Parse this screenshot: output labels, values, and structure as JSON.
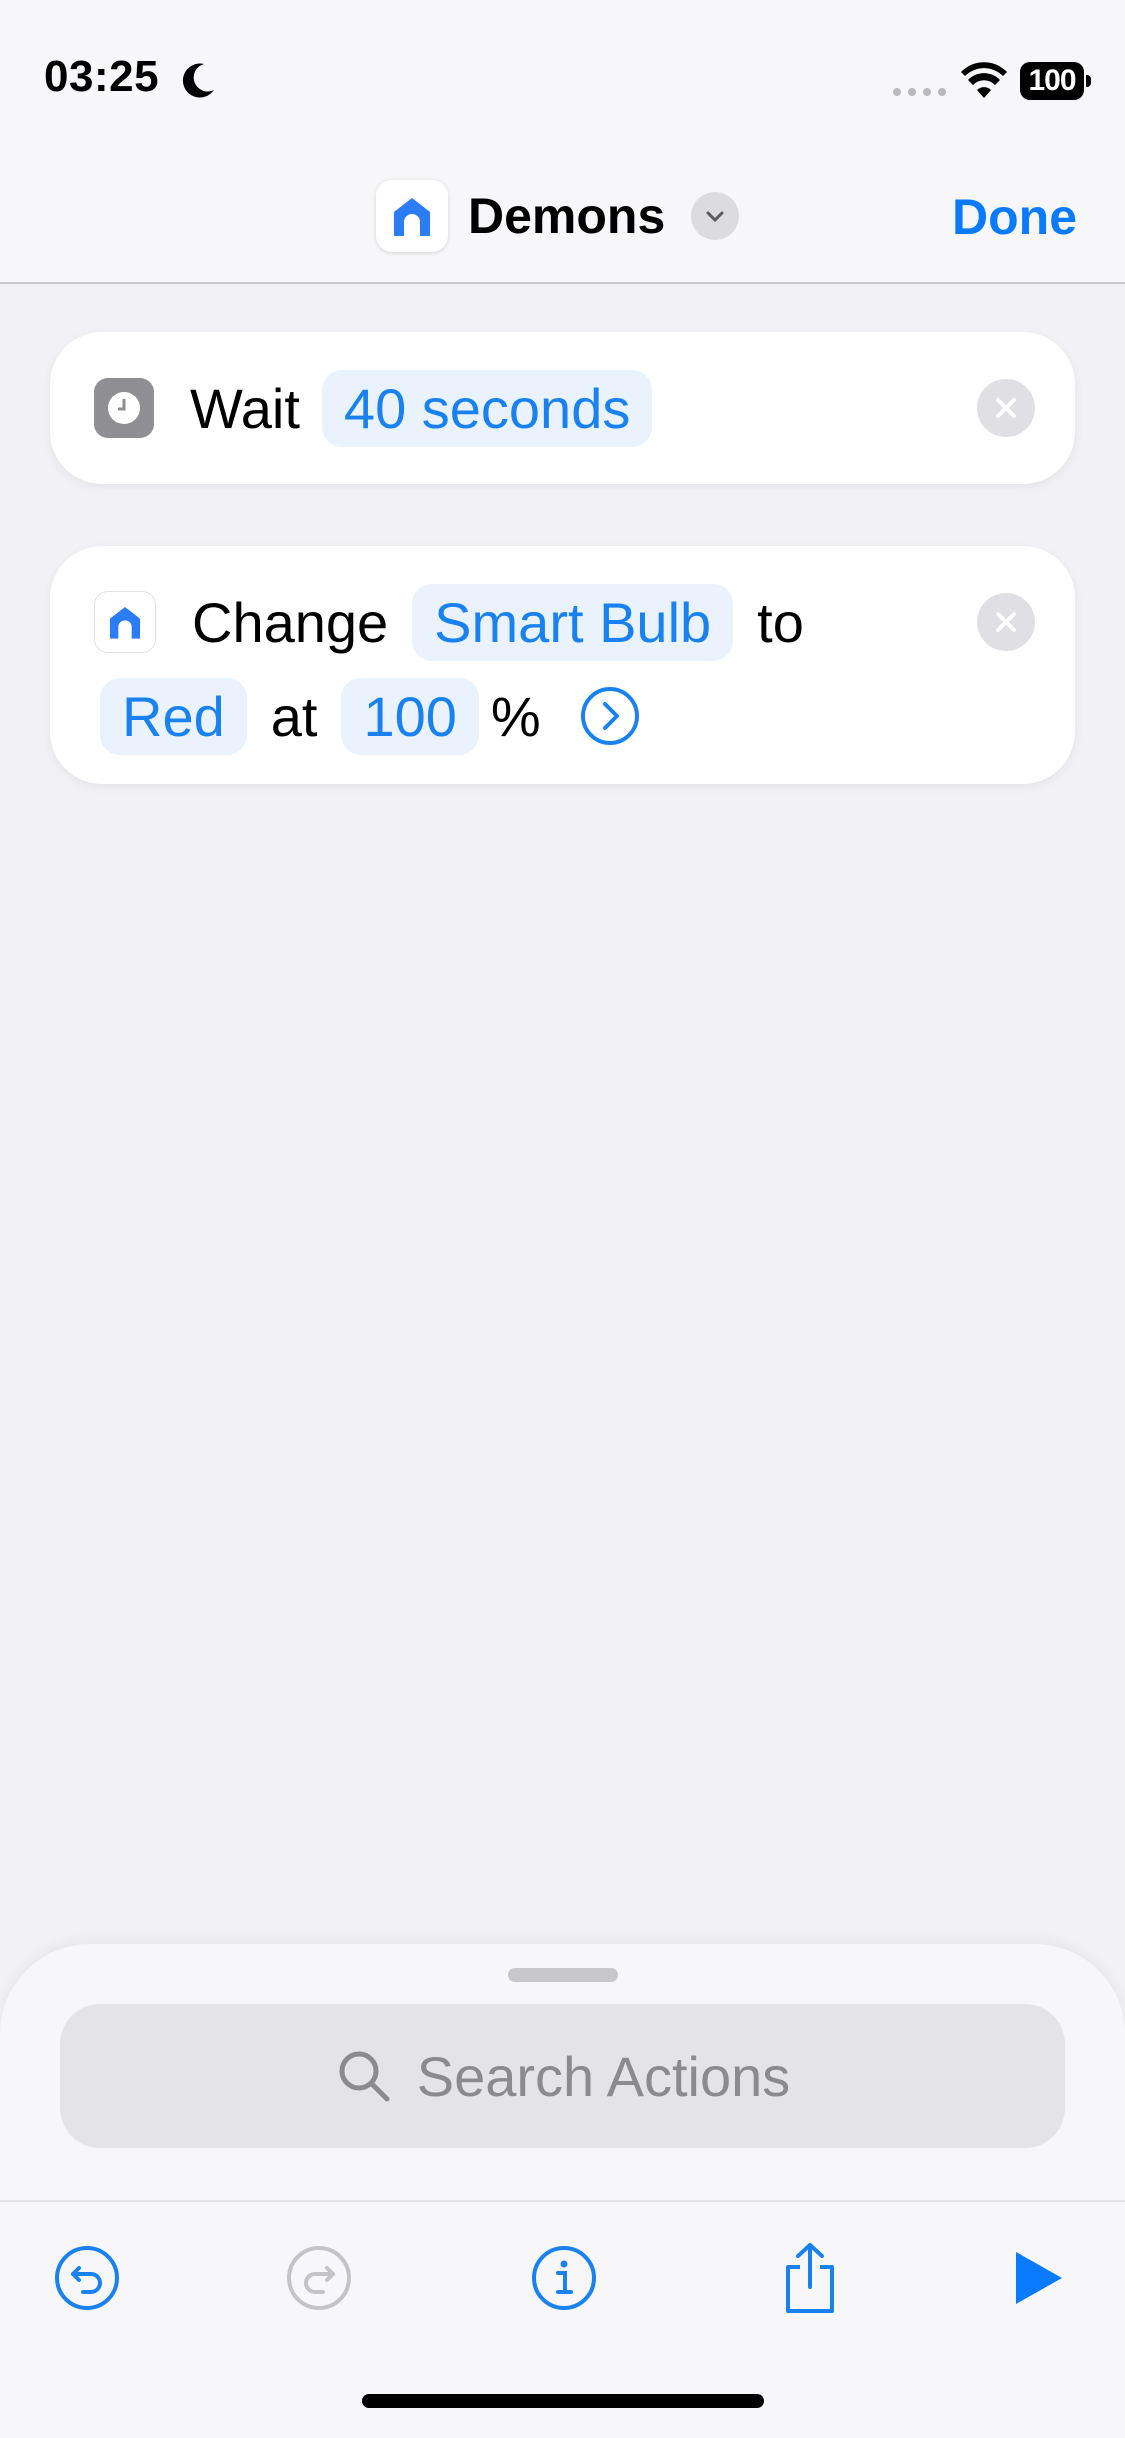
{
  "status_bar": {
    "time": "03:25",
    "battery": "100"
  },
  "nav": {
    "title": "Demons",
    "done_label": "Done"
  },
  "actions": {
    "wait": {
      "verb": "Wait",
      "duration": "40 seconds"
    },
    "change": {
      "verb": "Change",
      "device": "Smart Bulb",
      "to_word": "to",
      "color": "Red",
      "at_word": "at",
      "level": "100",
      "unit": "%"
    }
  },
  "search": {
    "placeholder": "Search Actions"
  },
  "icons": {
    "moon": "moon-icon",
    "wifi": "wifi-icon",
    "home": "home-icon",
    "clock": "clock-icon",
    "clear": "clear-icon",
    "undo": "undo-icon",
    "redo": "redo-icon",
    "info": "info-icon",
    "share": "share-icon",
    "play": "play-icon"
  },
  "colors": {
    "accent": "#0a7aff",
    "token_bg": "#e9f2fd",
    "background": "#f1f1f6"
  }
}
